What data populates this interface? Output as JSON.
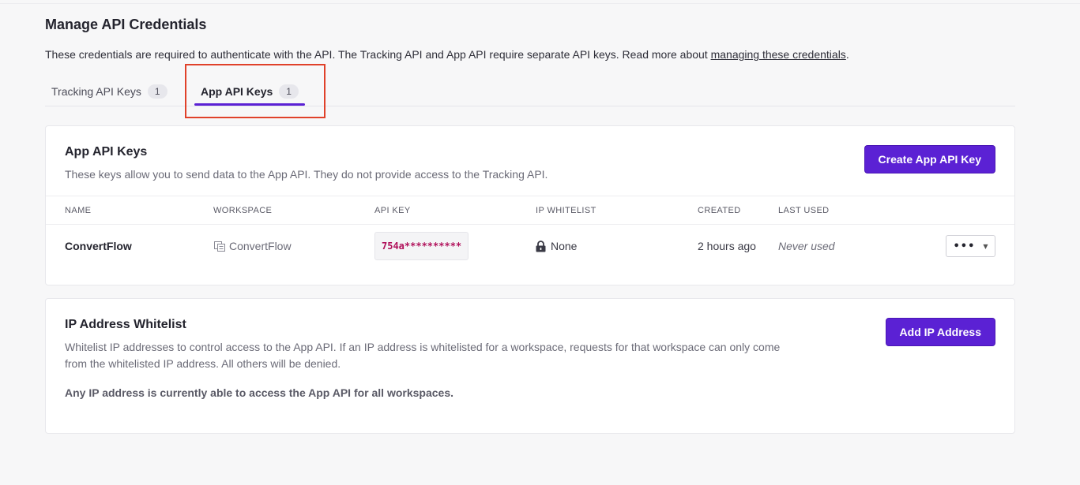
{
  "page": {
    "title": "Manage API Credentials",
    "intro_text": "These credentials are required to authenticate with the API. The Tracking API and App API require separate API keys. Read more about ",
    "intro_link": "managing these credentials",
    "intro_end": "."
  },
  "tabs": [
    {
      "label": "Tracking API Keys",
      "count": "1",
      "active": false
    },
    {
      "label": "App API Keys",
      "count": "1",
      "active": true
    }
  ],
  "app_keys": {
    "title": "App API Keys",
    "description": "These keys allow you to send data to the App API. They do not provide access to the Tracking API.",
    "create_button": "Create App API Key",
    "columns": [
      "NAME",
      "WORKSPACE",
      "API KEY",
      "IP WHITELIST",
      "CREATED",
      "LAST USED"
    ],
    "rows": [
      {
        "name": "ConvertFlow",
        "workspace": "ConvertFlow",
        "api_key": "754a**********",
        "ip_whitelist": "None",
        "created": "2 hours ago",
        "last_used": "Never used"
      }
    ]
  },
  "whitelist": {
    "title": "IP Address Whitelist",
    "description_line1": "Whitelist IP addresses to control access to the App API. If an IP address is whitelisted for a workspace, requests for that workspace can only come",
    "description_line2": "from the whitelisted IP address. All others will be denied.",
    "add_button": "Add IP Address",
    "status_note": "Any IP address is currently able to access the App API for all workspaces."
  },
  "icons": {
    "workspace": "workspace-icon",
    "lock": "lock-icon",
    "more": "more-options-icon",
    "caret": "caret-down-icon"
  },
  "colors": {
    "accent": "#5b21d4",
    "highlight": "#e0412a",
    "api_key_text": "#b0105a"
  }
}
